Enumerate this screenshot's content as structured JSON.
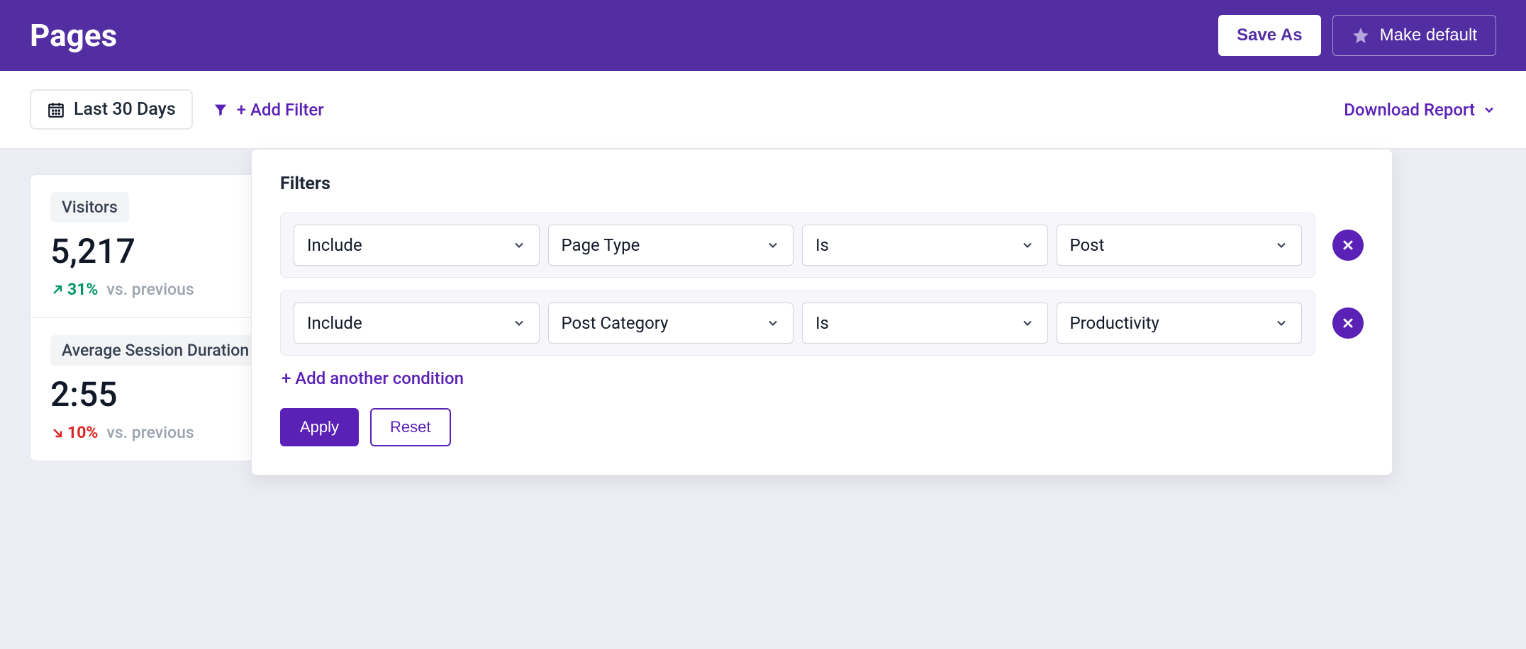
{
  "header": {
    "title": "Pages",
    "save_as": "Save As",
    "make_default": "Make default"
  },
  "toolbar": {
    "date_range": "Last 30 Days",
    "add_filter": "+ Add Filter",
    "download_report": "Download Report"
  },
  "cards": [
    {
      "label": "Visitors",
      "value": "5,217",
      "change_dir": "up",
      "change_pct": "31%",
      "compare": "vs. previous"
    },
    {
      "label": "Average Session Duration",
      "value": "2:55",
      "change_dir": "down",
      "change_pct": "10%",
      "compare": "vs. previous"
    }
  ],
  "filters_popover": {
    "title": "Filters",
    "rows": [
      {
        "mode": "Include",
        "field": "Page Type",
        "op": "Is",
        "value": "Post"
      },
      {
        "mode": "Include",
        "field": "Post Category",
        "op": "Is",
        "value": "Productivity"
      }
    ],
    "add_condition": "+ Add another condition",
    "apply": "Apply",
    "reset": "Reset"
  }
}
